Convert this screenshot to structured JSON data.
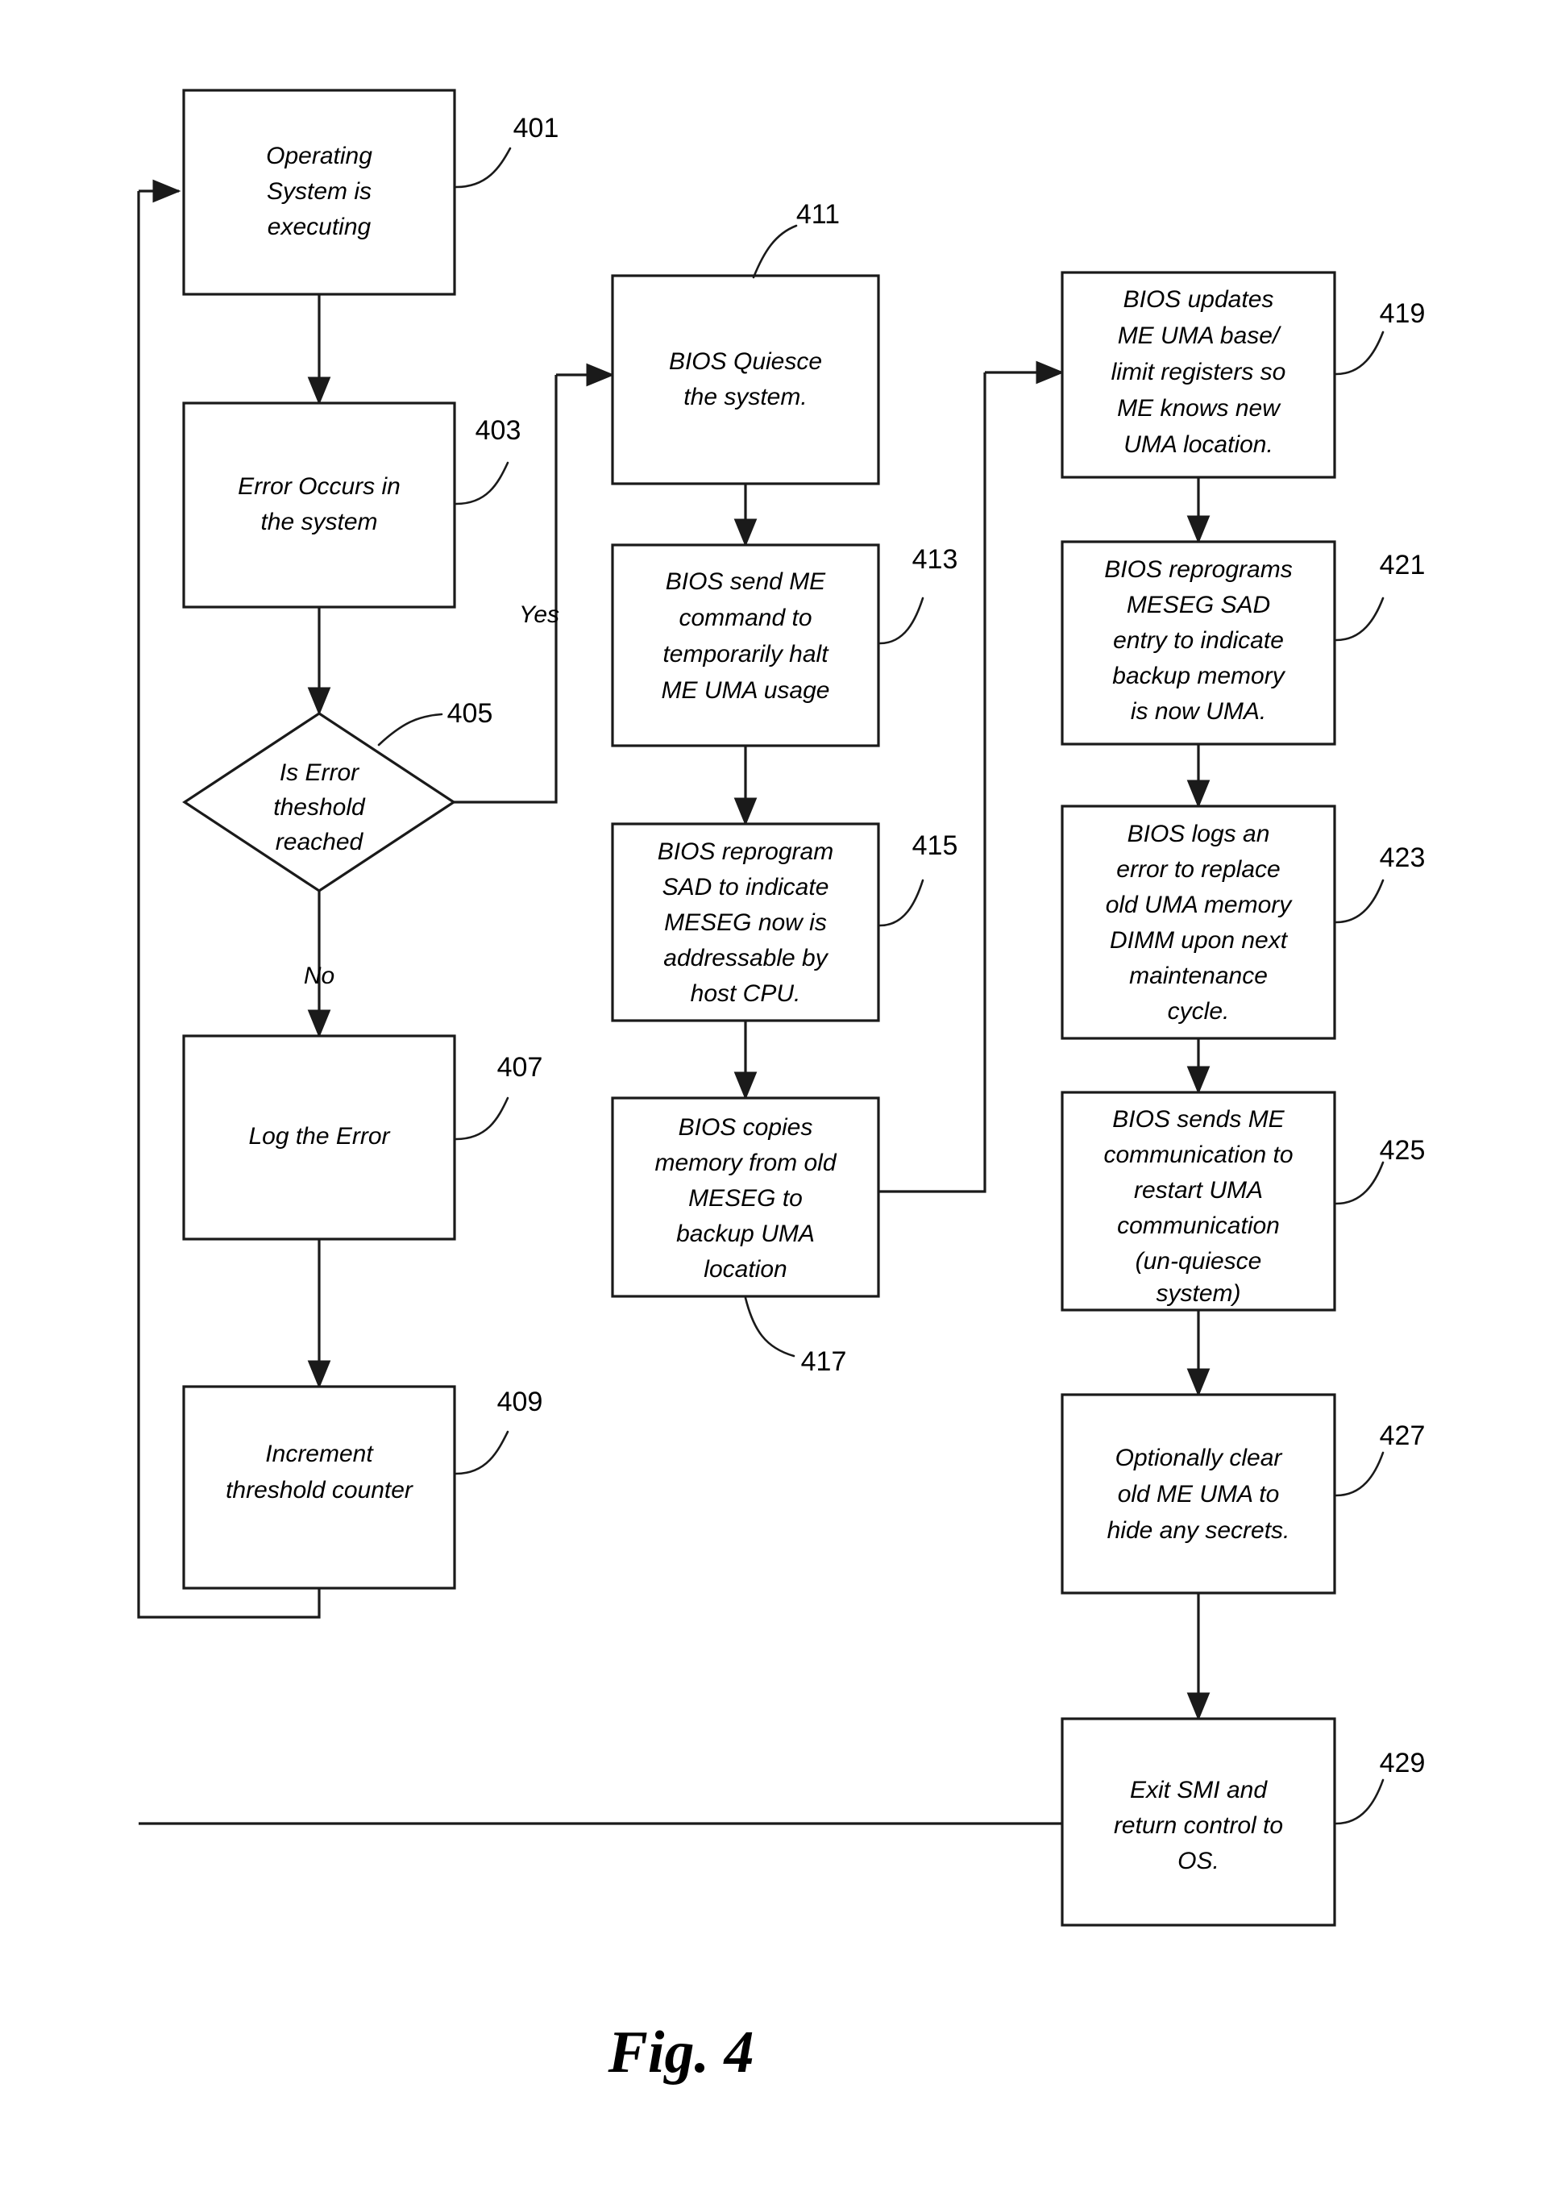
{
  "figure": {
    "caption": "Fig. 4",
    "edge_labels": {
      "yes": "Yes",
      "no": "No"
    }
  },
  "nodes": {
    "n401": {
      "ref": "401",
      "shape": "process",
      "lines": [
        "Operating",
        "System is",
        "executing"
      ],
      "text": "Operating System is executing"
    },
    "n403": {
      "ref": "403",
      "shape": "process",
      "lines": [
        "Error Occurs in",
        "the system"
      ],
      "text": "Error Occurs in the system"
    },
    "n405": {
      "ref": "405",
      "shape": "decision",
      "lines": [
        "Is Error",
        "theshold",
        "reached"
      ],
      "text": "Is Error theshold reached"
    },
    "n407": {
      "ref": "407",
      "shape": "process",
      "lines": [
        "Log the Error"
      ],
      "text": "Log the Error"
    },
    "n409": {
      "ref": "409",
      "shape": "process",
      "lines": [
        "Increment",
        "threshold counter"
      ],
      "text": "Increment threshold counter"
    },
    "n411": {
      "ref": "411",
      "shape": "process",
      "lines": [
        "BIOS Quiesce",
        "the system."
      ],
      "text": "BIOS Quiesce the system."
    },
    "n413": {
      "ref": "413",
      "shape": "process",
      "lines": [
        "BIOS send ME",
        "command to",
        "temporarily halt",
        "ME UMA usage"
      ],
      "text": "BIOS send ME command to temporarily halt ME UMA usage"
    },
    "n415": {
      "ref": "415",
      "shape": "process",
      "lines": [
        "BIOS reprogram",
        "SAD to indicate",
        "MESEG now is",
        "addressable by",
        "host CPU."
      ],
      "text": "BIOS reprogram SAD to indicate MESEG now is addressable by host CPU."
    },
    "n417": {
      "ref": "417",
      "shape": "process",
      "lines": [
        "BIOS copies",
        "memory from old",
        "MESEG to",
        "backup UMA",
        "location"
      ],
      "text": "BIOS copies memory from old MESEG to backup UMA location"
    },
    "n419": {
      "ref": "419",
      "shape": "process",
      "lines": [
        "BIOS updates",
        "ME UMA base/",
        "limit registers so",
        "ME knows new",
        "UMA location."
      ],
      "text": "BIOS updates ME UMA base/ limit registers so ME knows new UMA location."
    },
    "n421": {
      "ref": "421",
      "shape": "process",
      "lines": [
        "BIOS reprograms",
        "MESEG SAD",
        "entry to indicate",
        "backup memory",
        "is now UMA."
      ],
      "text": "BIOS reprograms MESEG SAD entry to indicate backup memory is now UMA."
    },
    "n423": {
      "ref": "423",
      "shape": "process",
      "lines": [
        "BIOS logs an",
        "error to replace",
        "old UMA memory",
        "DIMM upon next",
        "maintenance",
        "cycle."
      ],
      "text": "BIOS logs an error to replace old UMA memory DIMM upon next maintenance cycle."
    },
    "n425": {
      "ref": "425",
      "shape": "process",
      "lines": [
        "BIOS sends ME",
        "communication to",
        "restart UMA",
        "communication",
        "(un-quiesce",
        "system)"
      ],
      "text": "BIOS sends ME communication to restart UMA communication (un-quiesce system)"
    },
    "n427": {
      "ref": "427",
      "shape": "process",
      "lines": [
        "Optionally clear",
        "old ME UMA to",
        "hide any secrets."
      ],
      "text": "Optionally clear old ME UMA to hide any secrets."
    },
    "n429": {
      "ref": "429",
      "shape": "process",
      "lines": [
        "Exit SMI and",
        "return control to",
        "OS."
      ],
      "text": "Exit SMI and return control to OS."
    }
  },
  "colors": {
    "stroke": "#1a1a1a",
    "fill": "#ffffff",
    "text": "#000000"
  }
}
